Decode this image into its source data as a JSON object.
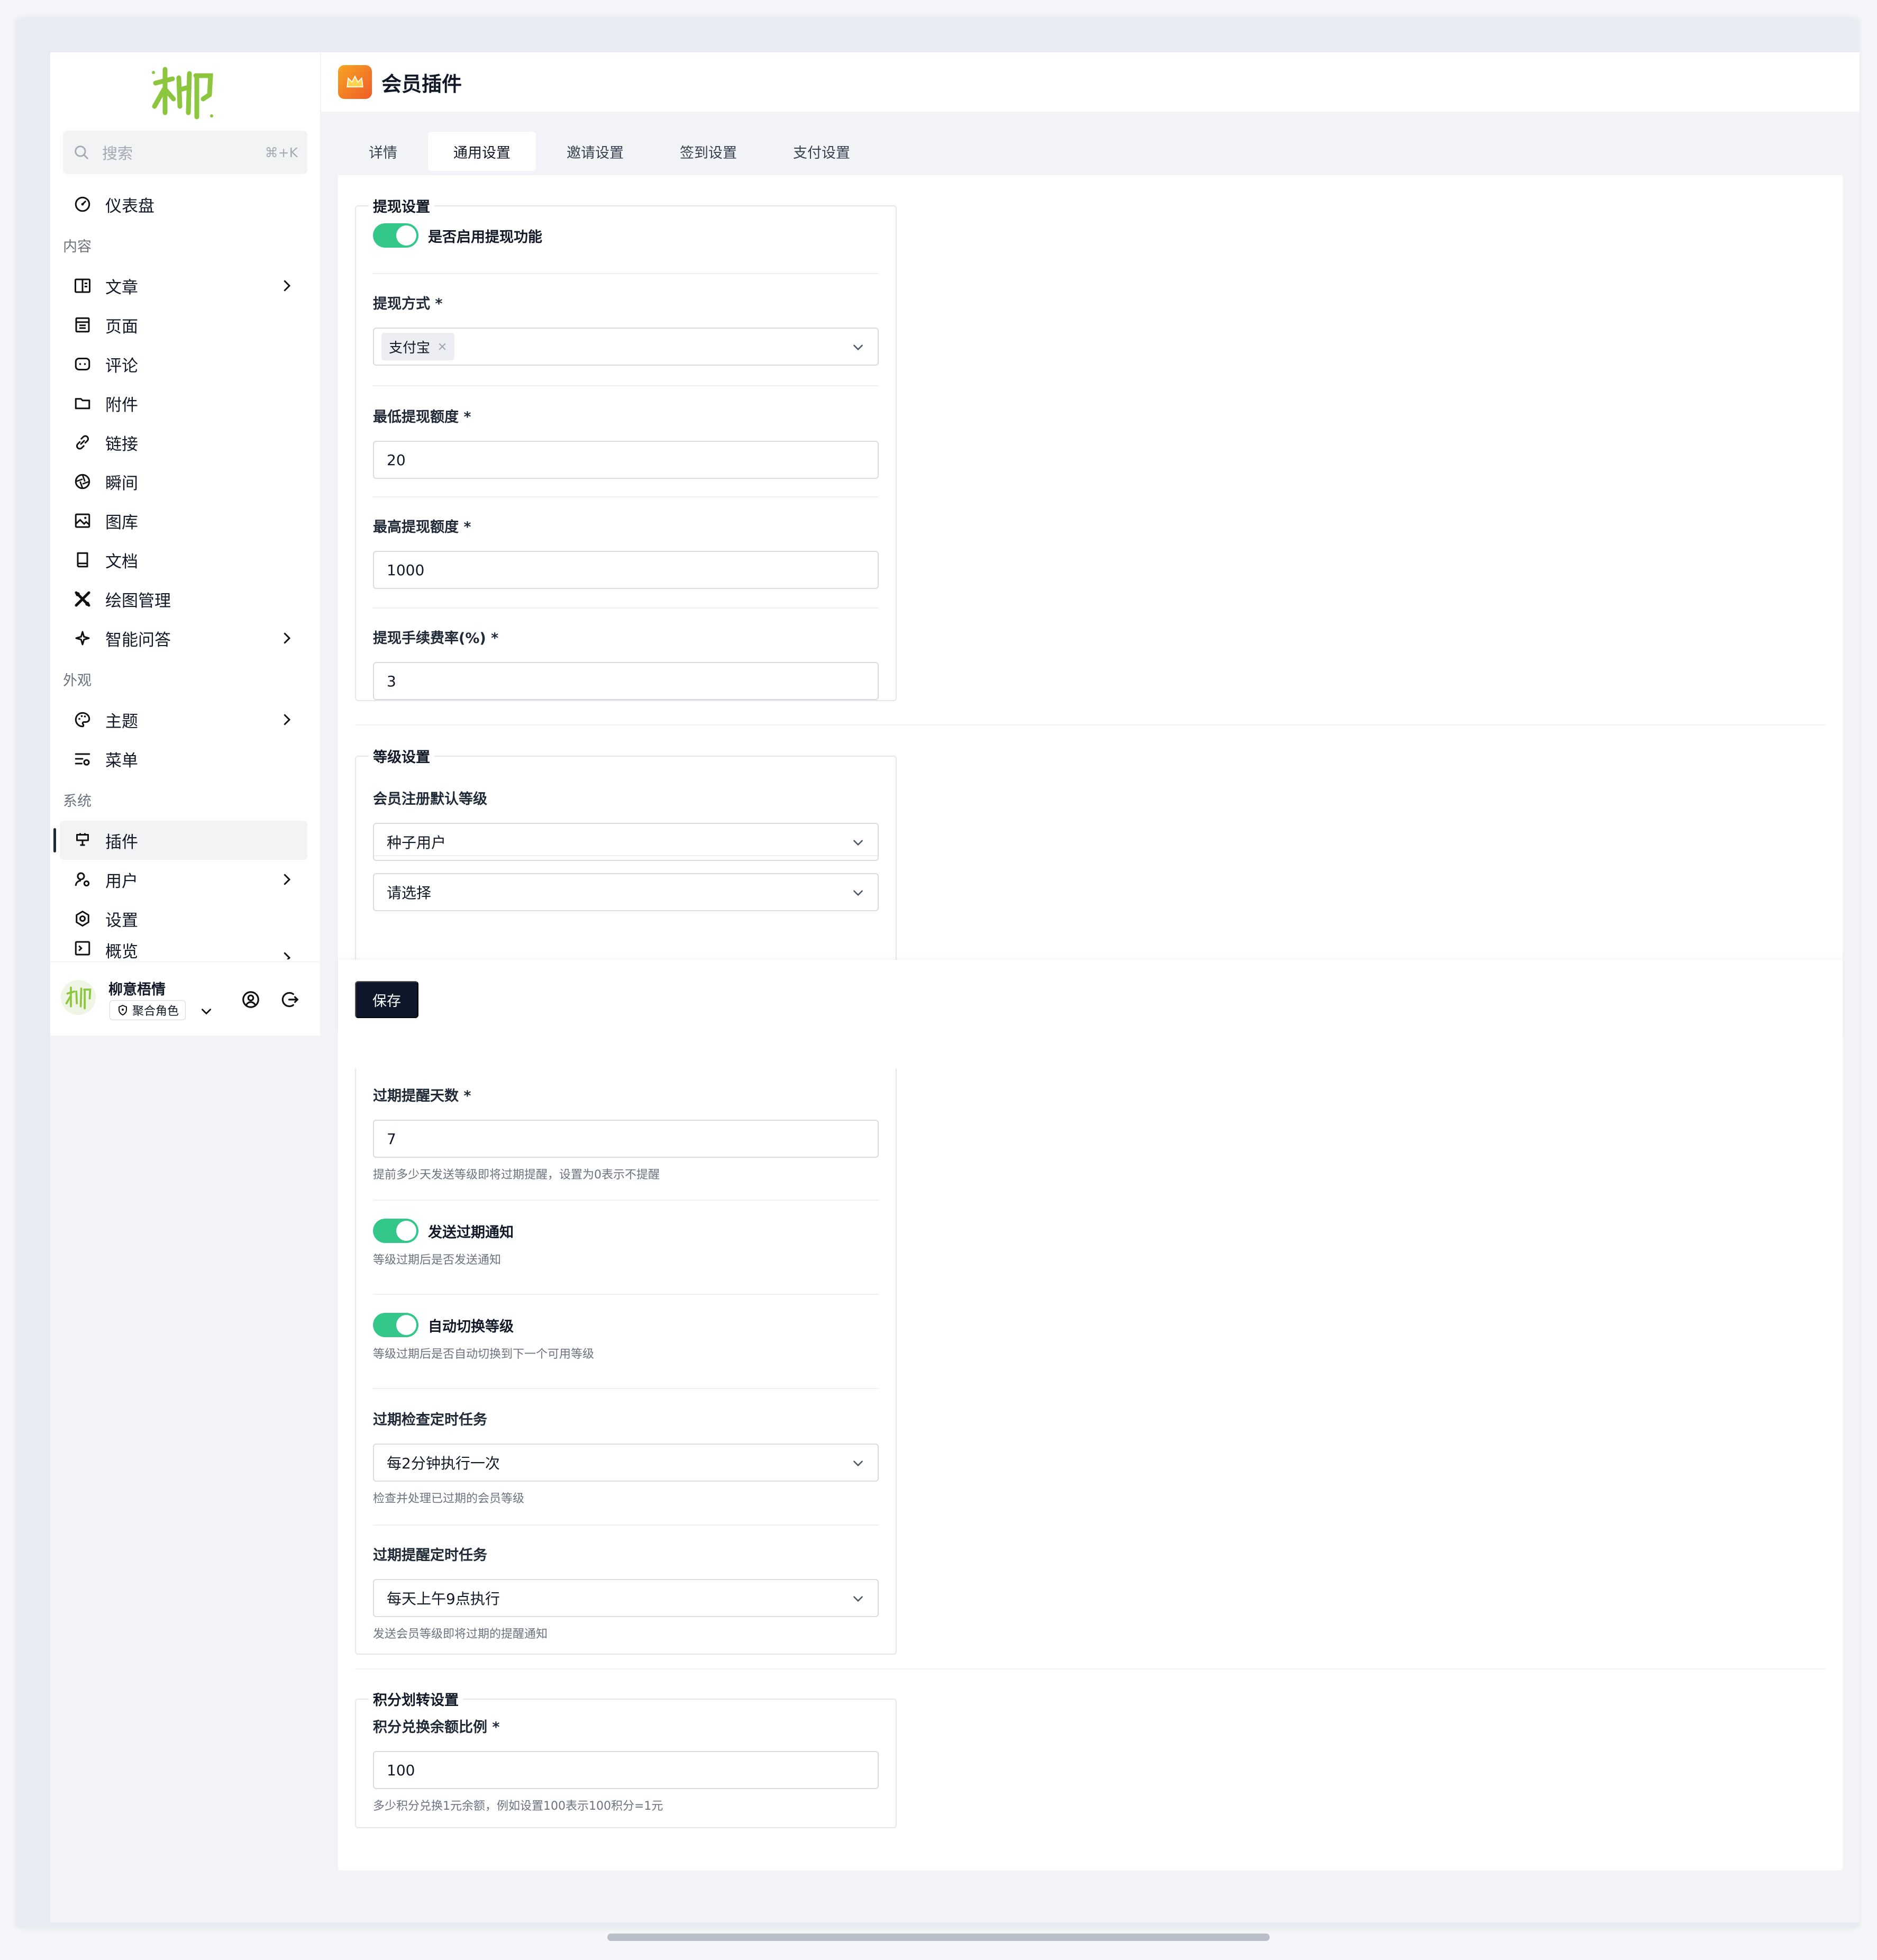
{
  "sidebar": {
    "search_placeholder": "搜索",
    "search_shortcut": "⌘+K",
    "dashboard": "仪表盘",
    "group_content": "内容",
    "posts": "文章",
    "pages": "页面",
    "comments": "评论",
    "attachments": "附件",
    "links": "链接",
    "moments": "瞬间",
    "gallery": "图库",
    "docs": "文档",
    "drawing": "绘图管理",
    "ai_qa": "智能问答",
    "group_appearance": "外观",
    "themes": "主题",
    "menus": "菜单",
    "group_system": "系统",
    "plugins": "插件",
    "users": "用户",
    "settings": "设置",
    "overview": "概览",
    "user_name": "柳意梧情",
    "user_role": "聚合角色"
  },
  "header": {
    "title": "会员插件"
  },
  "tabs": [
    "详情",
    "通用设置",
    "邀请设置",
    "签到设置",
    "支付设置"
  ],
  "withdraw": {
    "legend": "提现设置",
    "enable_label": "是否启用提现功能",
    "method_label": "提现方式 *",
    "method_value": "支付宝",
    "min_label": "最低提现额度 *",
    "min_value": "20",
    "max_label": "最高提现额度 *",
    "max_value": "1000",
    "fee_label": "提现手续费率(%) *",
    "fee_value": "3"
  },
  "level": {
    "legend": "等级设置",
    "default_label": "会员注册默认等级",
    "default_value": "种子用户",
    "select_placeholder": "请选择",
    "remind_days_label": "过期提醒天数 *",
    "remind_days_value": "7",
    "remind_days_help": "提前多少天发送等级即将过期提醒，设置为0表示不提醒",
    "notify_label": "发送过期通知",
    "notify_help": "等级过期后是否发送通知",
    "auto_switch_label": "自动切换等级",
    "auto_switch_help": "等级过期后是否自动切换到下一个可用等级",
    "check_task_label": "过期检查定时任务",
    "check_task_value": "每2分钟执行一次",
    "check_task_help": "检查并处理已过期的会员等级",
    "remind_task_label": "过期提醒定时任务",
    "remind_task_value": "每天上午9点执行",
    "remind_task_help": "发送会员等级即将过期的提醒通知"
  },
  "points": {
    "legend": "积分划转设置",
    "ratio_label": "积分兑换余额比例 *",
    "ratio_value": "100",
    "ratio_help": "多少积分兑换1元余额，例如设置100表示100积分=1元"
  },
  "save_label": "保存",
  "colors": {
    "toggle_on": "#34c78a",
    "primary_button": "#0e1629",
    "logo_green": "#8cc63f"
  }
}
